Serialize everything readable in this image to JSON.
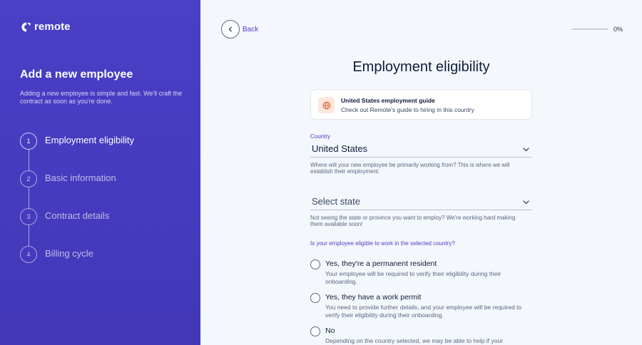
{
  "brand": {
    "logo_text": "remote"
  },
  "sidebar": {
    "title": "Add a new employee",
    "description": "Adding a new employee is simple and fast. We'll craft the contract as soon as you're done.",
    "steps": [
      {
        "number": "1",
        "label": "Employment eligibility",
        "active": true
      },
      {
        "number": "2",
        "label": "Basic information",
        "active": false
      },
      {
        "number": "3",
        "label": "Contract details",
        "active": false
      },
      {
        "number": "4",
        "label": "Billing cycle",
        "active": false
      }
    ]
  },
  "header": {
    "back_label": "Back",
    "progress_text": "0%",
    "progress_value": 0
  },
  "main": {
    "title": "Employment eligibility",
    "guide": {
      "title": "United States employment guide",
      "subtitle": "Check out Remote's guide to hiring in this country"
    },
    "country": {
      "label": "Country",
      "value": "United States",
      "helper": "Where will your new employee be primarily working from? This is where we will establish their employment."
    },
    "state": {
      "placeholder": "Select state",
      "helper": "Not seeing the state or province you want to employ? We're working hard making them available soon!"
    },
    "question": "Is your employee eligible to work in the selected country?",
    "options": [
      {
        "title": "Yes, they're a permanent resident",
        "desc": "Your employee will be required to verify their eligibility during their onboarding."
      },
      {
        "title": "Yes, they have a work permit",
        "desc": "You need to provide further details, and your employee will be required to verify their eligibility during their onboarding."
      },
      {
        "title": "No",
        "desc": "Depending on the country selected, we may be able to help if your"
      }
    ]
  },
  "colors": {
    "accent": "#4a3fc6",
    "sidebar_bg": "#4a3fc6",
    "page_bg": "#f4f7fb",
    "guide_icon_bg": "#fde6dc"
  },
  "icons": {
    "logo": "remote-logo-icon",
    "back": "chevron-left-icon",
    "guide": "globe-icon",
    "select": "chevron-down-icon"
  }
}
